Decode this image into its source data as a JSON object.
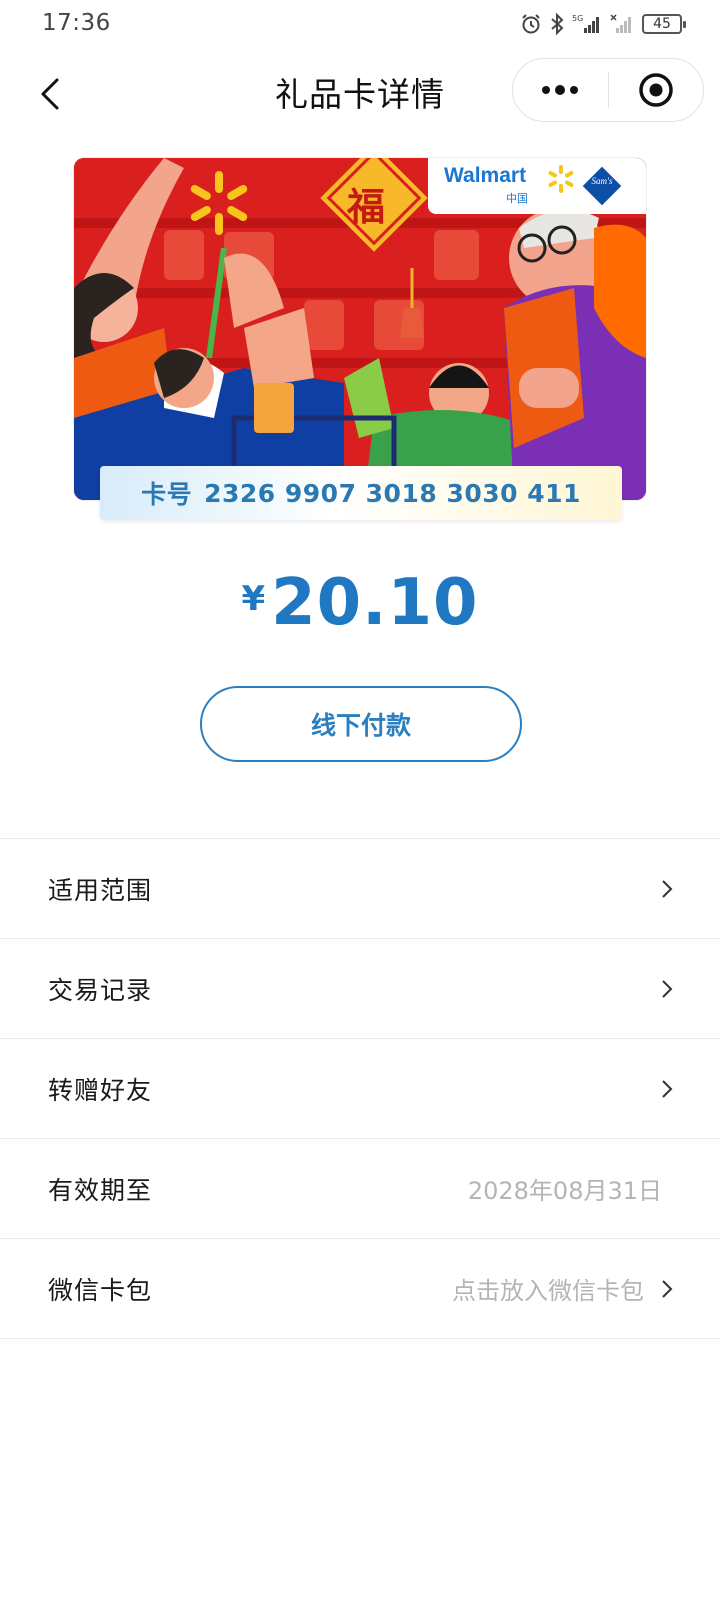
{
  "status_bar": {
    "time": "17:36",
    "battery": "45",
    "icons": [
      "alarm-icon",
      "bluetooth-icon",
      "signal-5g-icon",
      "signal-icon",
      "battery-icon"
    ]
  },
  "nav": {
    "title": "礼品卡详情",
    "back_icon": "back-chevron-icon",
    "more_icon": "more-dots-icon",
    "close_icon": "target-close-icon"
  },
  "card": {
    "brand": "Walmart",
    "brand_sub": "中国",
    "partner_logo": "Sam's",
    "card_number_label": "卡号",
    "card_number": "2326 9907 3018 3030 411",
    "colors": {
      "card_bg": "#d9201f",
      "accent": "#1f78c1"
    }
  },
  "balance": {
    "currency_symbol": "¥",
    "amount": "20.10"
  },
  "actions": {
    "pay_label": "线下付款"
  },
  "list": {
    "items": [
      {
        "label": "适用范围",
        "value": "",
        "has_chevron": true
      },
      {
        "label": "交易记录",
        "value": "",
        "has_chevron": true
      },
      {
        "label": "转赠好友",
        "value": "",
        "has_chevron": true
      },
      {
        "label": "有效期至",
        "value": "2028年08月31日",
        "has_chevron": false
      },
      {
        "label": "微信卡包",
        "value": "点击放入微信卡包",
        "has_chevron": true
      }
    ]
  }
}
